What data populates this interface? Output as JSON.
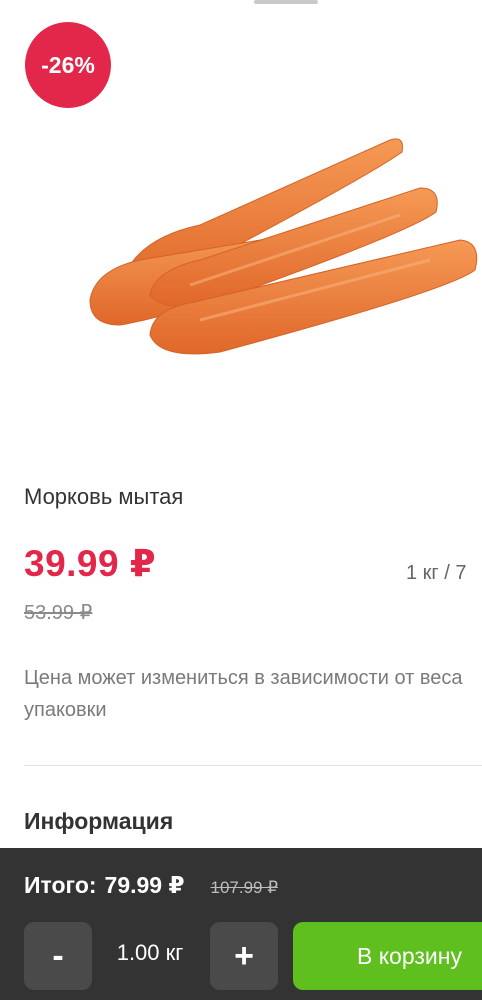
{
  "badge": {
    "discount": "-26%"
  },
  "product": {
    "title": "Морковь мытая",
    "price": "39.99 ₽",
    "old_price": "53.99 ₽",
    "unit_price": "1 кг / 7",
    "note": "Цена может измениться в зависимости от веса упаковки",
    "image": "carrots-image"
  },
  "info": {
    "heading": "Информация"
  },
  "cart_bar": {
    "total_label": "Итого:",
    "total_value": "79.99 ₽",
    "total_old": "107.99 ₽",
    "minus_label": "-",
    "quantity": "1.00 кг",
    "plus_label": "+",
    "add_to_cart": "В корзину"
  },
  "colors": {
    "accent_red": "#e3274b",
    "cart_green": "#5fbf1f",
    "bar_bg": "#333333"
  }
}
